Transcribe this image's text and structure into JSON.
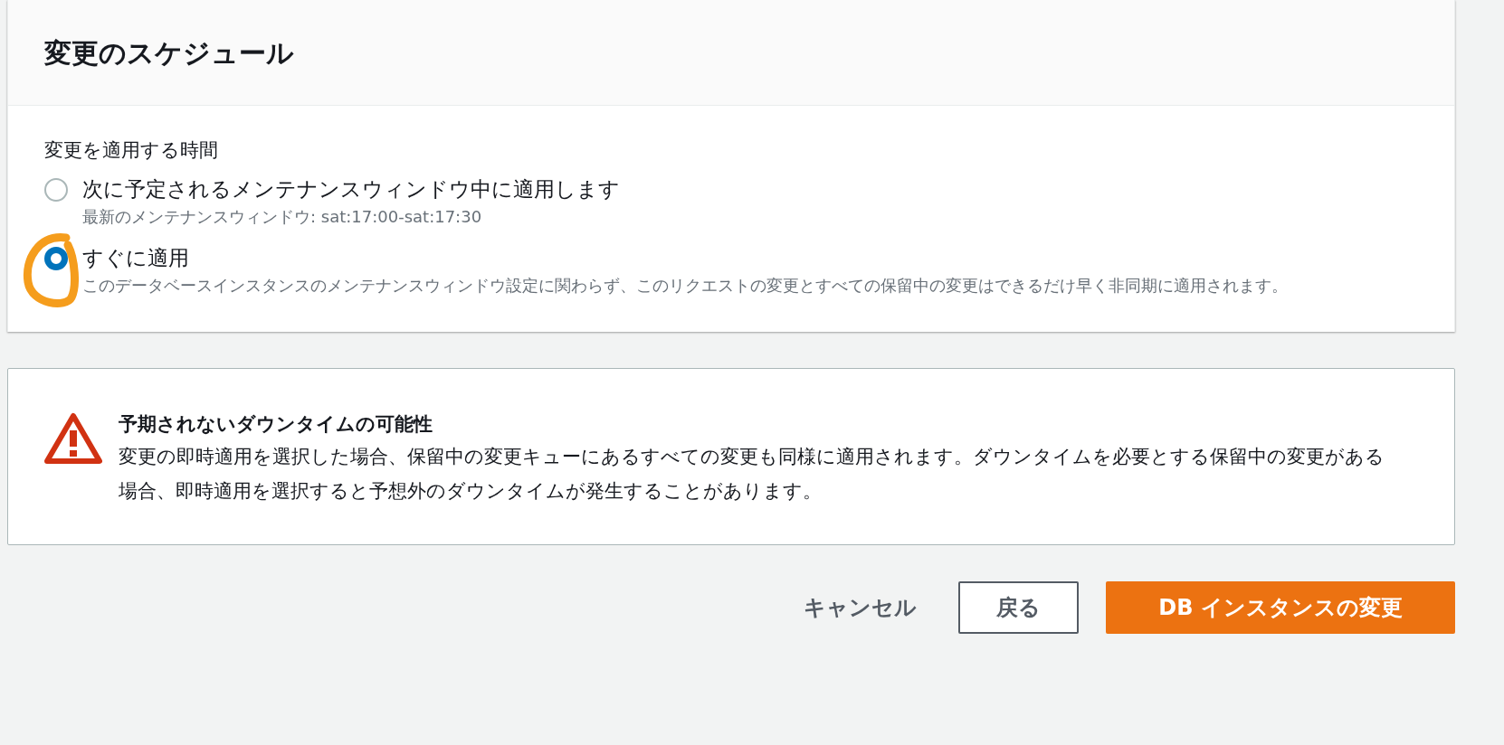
{
  "schedule": {
    "title": "変更のスケジュール",
    "field_label": "変更を適用する時間",
    "options": [
      {
        "label": "次に予定されるメンテナンスウィンドウ中に適用します",
        "description": "最新のメンテナンスウィンドウ: sat:17:00-sat:17:30",
        "selected": false
      },
      {
        "label": "すぐに適用",
        "description": "このデータベースインスタンスのメンテナンスウィンドウ設定に関わらず、このリクエストの変更とすべての保留中の変更はできるだけ早く非同期に適用されます。",
        "selected": true
      }
    ]
  },
  "warning": {
    "title": "予期されないダウンタイムの可能性",
    "body": "変更の即時適用を選択した場合、保留中の変更キューにあるすべての変更も同様に適用されます。ダウンタイムを必要とする保留中の変更がある場合、即時適用を選択すると予想外のダウンタイムが発生することがあります。"
  },
  "buttons": [
    {
      "label": "キャンセル",
      "kind": "link"
    },
    {
      "label": "戻る",
      "kind": "secondary"
    },
    {
      "label": "DB インスタンスの変更",
      "kind": "primary"
    }
  ]
}
